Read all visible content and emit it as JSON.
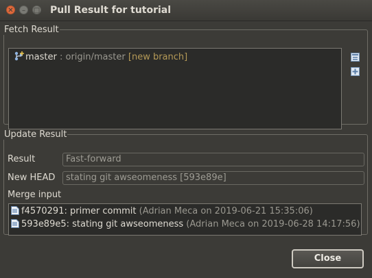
{
  "window": {
    "title": "Pull Result for tutorial",
    "controls": [
      "close",
      "minimize",
      "maximize"
    ]
  },
  "fetch_result": {
    "legend": "Fetch Result",
    "items": [
      {
        "icon": "branch-icon",
        "name": "master",
        "separator": " : ",
        "remote": "origin/master",
        "status": " [new branch]"
      }
    ],
    "tools": [
      "collapse-all-icon",
      "expand-all-icon"
    ]
  },
  "update_result": {
    "legend": "Update Result",
    "result_label": "Result",
    "result_value": "Fast-forward",
    "new_head_label": "New HEAD",
    "new_head_value": "stating git awseomeness [593e89e]",
    "merge_input_label": "Merge input",
    "merge_input": [
      {
        "id": "f4570291",
        "message": ": primer commit",
        "meta": " (Adrian Meca on 2019-06-21 15:35:06)"
      },
      {
        "id": "593e89e5",
        "message": ": stating git awseomeness",
        "meta": " (Adrian Meca on 2019-06-28 14:17:56)"
      }
    ]
  },
  "buttons": {
    "close_label": "Close"
  },
  "colors": {
    "window_bg": "#3c3b37",
    "list_bg": "#2b2b29",
    "new_branch": "#b59a57",
    "close_btn": "#e0693b"
  }
}
